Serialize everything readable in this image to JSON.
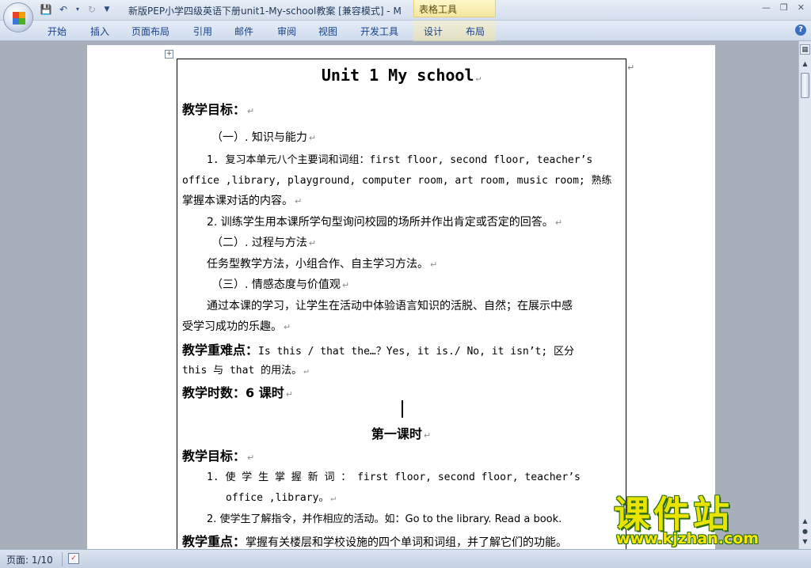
{
  "window": {
    "title": "新版PEP小学四级英语下册unit1-My-school教案 [兼容模式] - M",
    "context_tab_group": "表格工具"
  },
  "ribbon": {
    "tabs": [
      "开始",
      "插入",
      "页面布局",
      "引用",
      "邮件",
      "审阅",
      "视图",
      "开发工具",
      "设计",
      "布局"
    ]
  },
  "icons": {
    "office_button": "office-logo-icon",
    "save": "save-icon",
    "undo": "undo-icon",
    "redo": "redo-icon",
    "customize": "qat-dropdown-icon",
    "help": "help-icon"
  },
  "document": {
    "title": "Unit 1 My school",
    "goals_heading": "教学目标：",
    "sec1": "（一）. 知识与能力",
    "item1_a": "1. 复习本单元八个主要词和词组：first floor, second floor, teacher’s",
    "item1_b": "office ,library, playground, computer room, art room, music room; 熟练",
    "item1_c": "掌握本课对话的内容。",
    "item2": "2. 训练学生用本课所学句型询问校园的场所并作出肯定或否定的回答。",
    "sec2": "（二）. 过程与方法",
    "sec2_text": "任务型教学方法，小组合作、自主学习方法。",
    "sec3": "（三）. 情感态度与价值观",
    "sec3_text_a": "通过本课的学习，让学生在活动中体验语言知识的活脱、自然；在展示中感",
    "sec3_text_b": "受学习成功的乐趣。",
    "key_label": "教学重难点：",
    "key_text": "Is this / that the…？Yes, it is./ No, it isn’t; 区分",
    "key_text_b": "this 与 that 的用法。",
    "hours": "教学时数：6 课时",
    "lesson1_title": "第一课时",
    "goals2_heading": "教学目标：",
    "g2_item1_a": "1. 使 学 生 掌 握 新 词 ： first  floor,  second  floor,  teacher’s",
    "g2_item1_b": "office ,library。",
    "g2_item2": "2. 使学生了解指令，并作相应的活动。如：Go to the library. Read a book.",
    "focus_label": "教学重点：",
    "focus_text": "掌握有关楼层和学校设施的四个单词和词组，并了解它们的功能。"
  },
  "watermark": {
    "brand": "课件站",
    "url": "www.kjzhan.com"
  },
  "status": {
    "page": "页面: 1/10"
  }
}
